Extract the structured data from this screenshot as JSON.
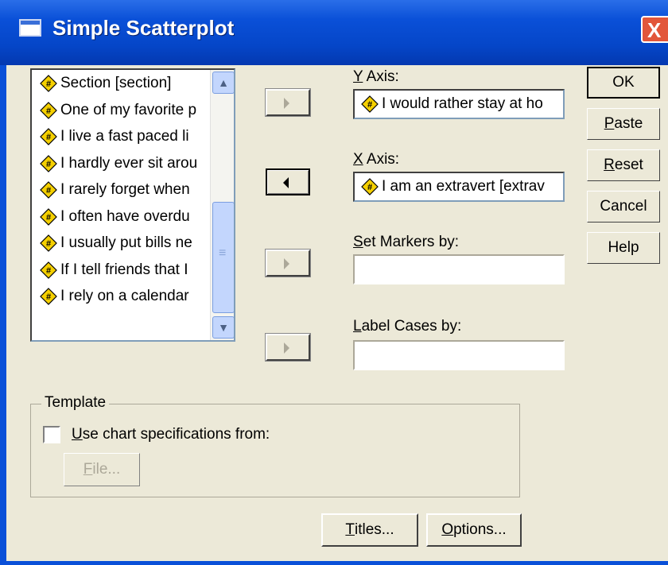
{
  "window": {
    "title": "Simple Scatterplot",
    "close_label": "X"
  },
  "variables": [
    {
      "label": "Section [section]",
      "icon": "numeric-scale-icon"
    },
    {
      "label": "One of my favorite p",
      "icon": "numeric-scale-icon"
    },
    {
      "label": "I live a fast paced li",
      "icon": "numeric-scale-icon"
    },
    {
      "label": "I hardly ever sit arou",
      "icon": "numeric-scale-icon"
    },
    {
      "label": "I rarely forget when",
      "icon": "numeric-scale-icon"
    },
    {
      "label": "I often have overdu",
      "icon": "numeric-scale-icon"
    },
    {
      "label": "I usually put bills ne",
      "icon": "numeric-scale-icon"
    },
    {
      "label": "If I tell friends that I",
      "icon": "numeric-scale-icon"
    },
    {
      "label": "I rely on a calendar",
      "icon": "numeric-scale-icon"
    }
  ],
  "y_axis": {
    "label_prefix": "Y",
    "label_rest": " Axis:",
    "value": "I would rather stay at ho"
  },
  "x_axis": {
    "label_prefix": "X",
    "label_rest": " Axis:",
    "value": "I am an extravert [extrav"
  },
  "set_markers": {
    "label_prefix": "S",
    "label_rest": "et Markers by:",
    "value": ""
  },
  "label_cases": {
    "label_prefix": "L",
    "label_rest": "abel Cases by:",
    "value": ""
  },
  "buttons": {
    "ok": "OK",
    "paste_prefix": "P",
    "paste_rest": "aste",
    "reset_prefix": "R",
    "reset_rest": "eset",
    "cancel": "Cancel",
    "help": "Help",
    "titles_prefix": "T",
    "titles_rest": "itles...",
    "options_prefix": "O",
    "options_rest": "ptions..."
  },
  "template": {
    "legend": "Template",
    "checkbox_prefix": "U",
    "checkbox_rest": "se chart specifications from:",
    "checked": false,
    "file_prefix": "F",
    "file_rest": "ile..."
  },
  "colors": {
    "titlebar": "#0a50d8",
    "dialog_bg": "#ece9d8",
    "close": "#e2563a",
    "icon_yellow": "#f5d000"
  }
}
